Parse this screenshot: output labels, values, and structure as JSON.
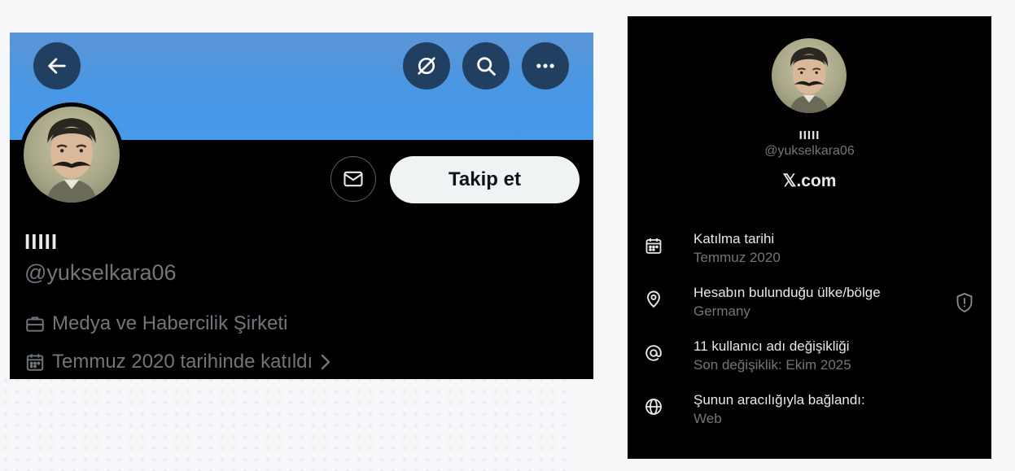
{
  "profile_card": {
    "display_name": "IIIII",
    "handle": "@yukselkara06",
    "category": "Medya ve Habercilik Şirketi",
    "joined": "Temmuz 2020 tarihinde katıldı",
    "follow_label": "Takip et",
    "icons": {
      "back": "arrow-left-icon",
      "grok": "grok-icon",
      "search": "search-icon",
      "more": "more-icon",
      "message": "mail-icon",
      "category": "briefcase-icon",
      "joined": "calendar-icon",
      "chevron": "chevron-right-icon"
    },
    "colors": {
      "banner": "#4797e6",
      "button_bg": "#213f60",
      "follow_bg": "#eff3f4"
    }
  },
  "about_panel": {
    "display_name": "IIIII",
    "handle": "@yukselkara06",
    "site": "𝕏.com",
    "rows": [
      {
        "icon": "calendar-icon",
        "title": "Katılma tarihi",
        "value": "Temmuz 2020"
      },
      {
        "icon": "location-pin-icon",
        "title": "Hesabın bulunduğu ülke/bölge",
        "value": "Germany"
      },
      {
        "icon": "at-sign-icon",
        "title": "11 kullanıcı adı değişikliği",
        "value": "Son değişiklik: Ekim 2025"
      },
      {
        "icon": "globe-icon",
        "title": "Şunun aracılığıyla bağlandı:",
        "value": "Web"
      }
    ],
    "shield_icon": "shield-alert-icon"
  }
}
